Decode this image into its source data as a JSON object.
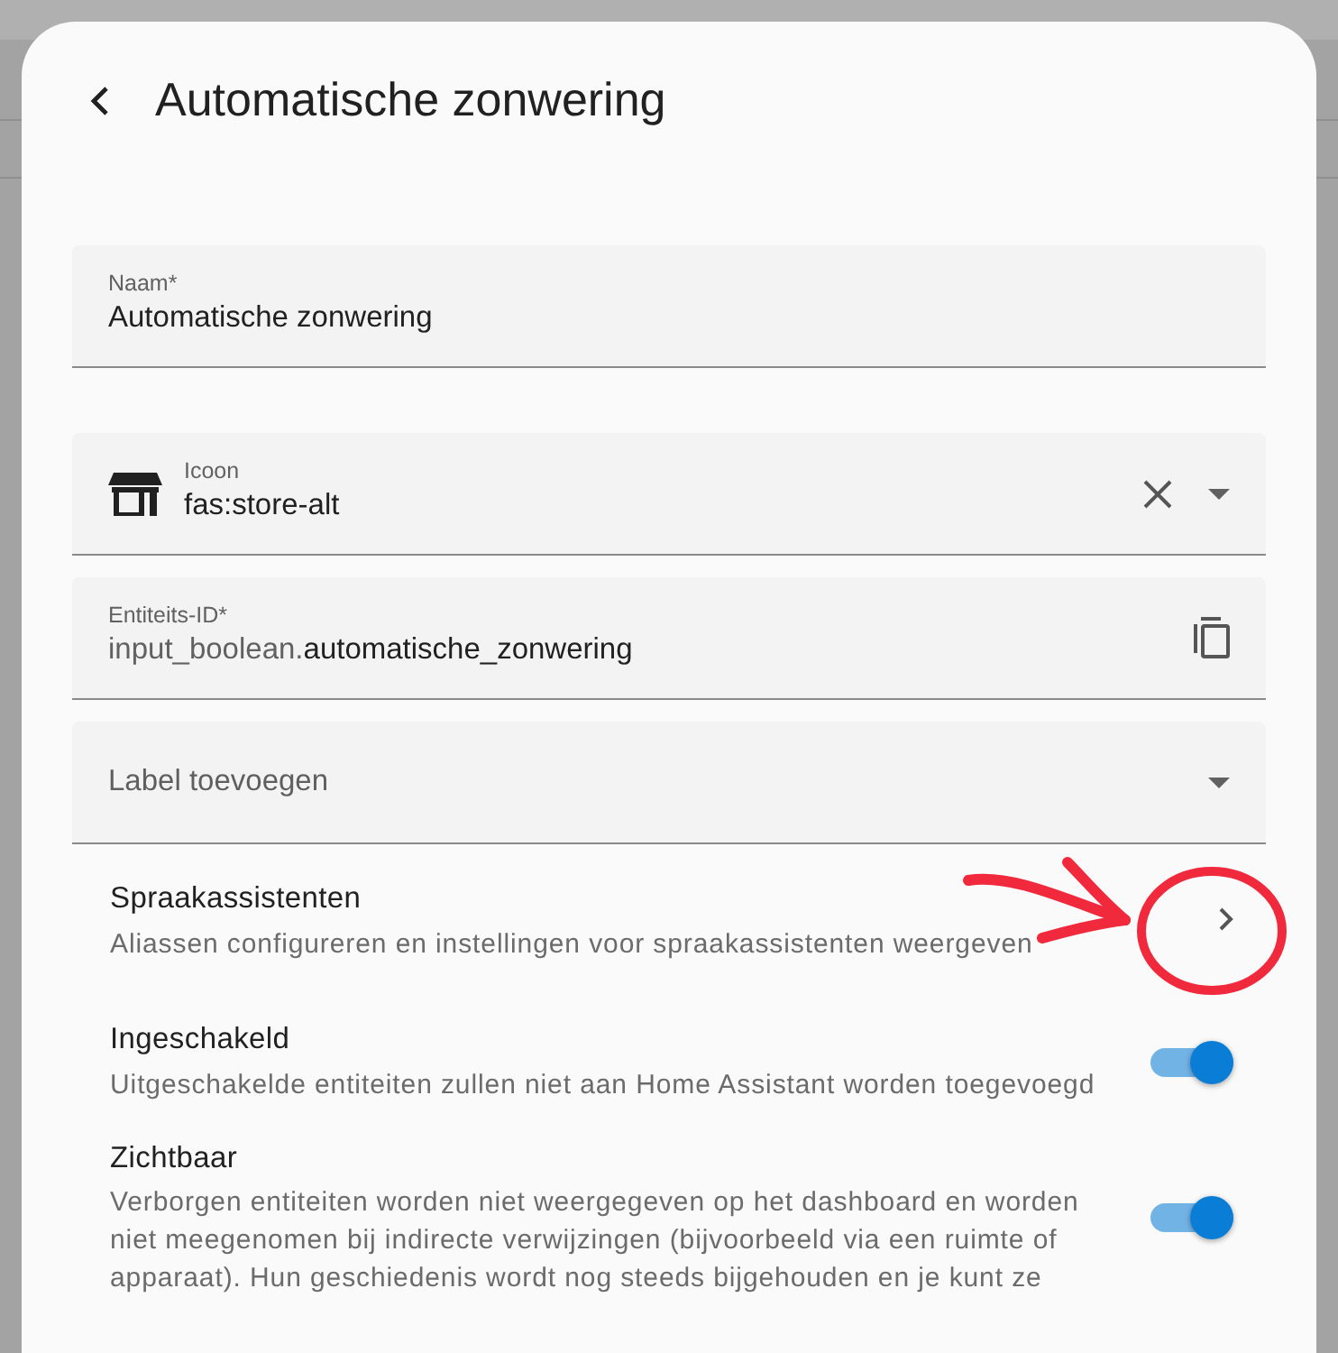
{
  "dialog": {
    "title": "Automatische zonwering"
  },
  "fields": [
    {
      "kind": "text",
      "label": "Naam*",
      "value": "Automatische zonwering"
    },
    {
      "kind": "icon",
      "label": "Icoon",
      "value": "fas:store-alt"
    },
    {
      "kind": "entity",
      "label": "Entiteits-ID*",
      "prefix": "input_boolean.",
      "value": "automatische_zonwering"
    },
    {
      "kind": "select",
      "placeholder": "Label toevoegen"
    }
  ],
  "settings": [
    {
      "kind": "link",
      "title": "Spraakassistenten",
      "description": "Aliassen configureren en instellingen voor spraakassistenten weergeven"
    },
    {
      "kind": "toggle",
      "title": "Ingeschakeld",
      "description": "Uitgeschakelde entiteiten zullen niet aan Home Assistant worden toegevoegd",
      "on": true
    },
    {
      "kind": "toggle",
      "title": "Zichtbaar",
      "description": "Verborgen entiteiten worden niet weergegeven op het dashboard en worden niet meegenomen bij indirecte verwijzingen (bijvoorbeeld via een ruimte of apparaat). Hun geschiedenis wordt nog steeds bijgehouden en je kunt ze",
      "on": true
    }
  ]
}
